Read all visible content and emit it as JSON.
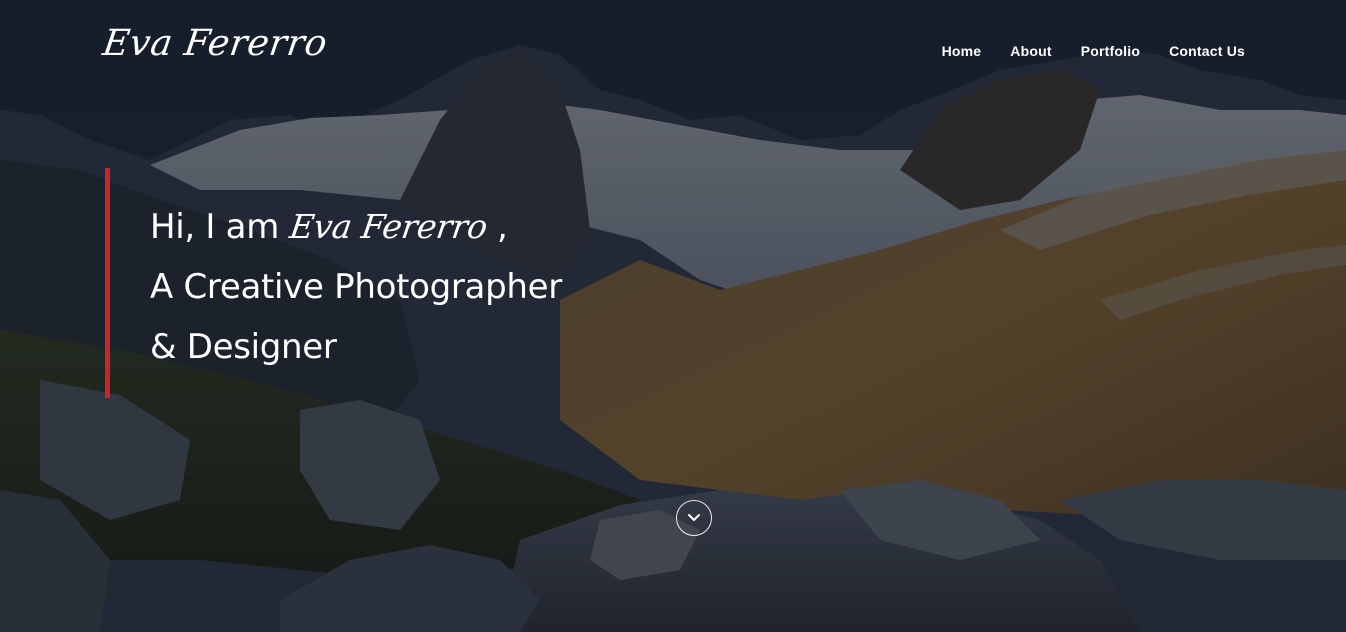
{
  "brand": {
    "logo_text": "Eva Fererro",
    "accent_color": "#c8242c"
  },
  "nav": {
    "items": [
      {
        "label": "Home"
      },
      {
        "label": "About"
      },
      {
        "label": "Portfolio"
      },
      {
        "label": "Contact Us"
      }
    ]
  },
  "hero": {
    "greeting_prefix": "Hi, I am",
    "name": "Eva Fererro",
    "greeting_suffix": ",",
    "line2": "A Creative Photographer",
    "line3": "& Designer",
    "scroll_icon": "chevron-down-icon"
  }
}
